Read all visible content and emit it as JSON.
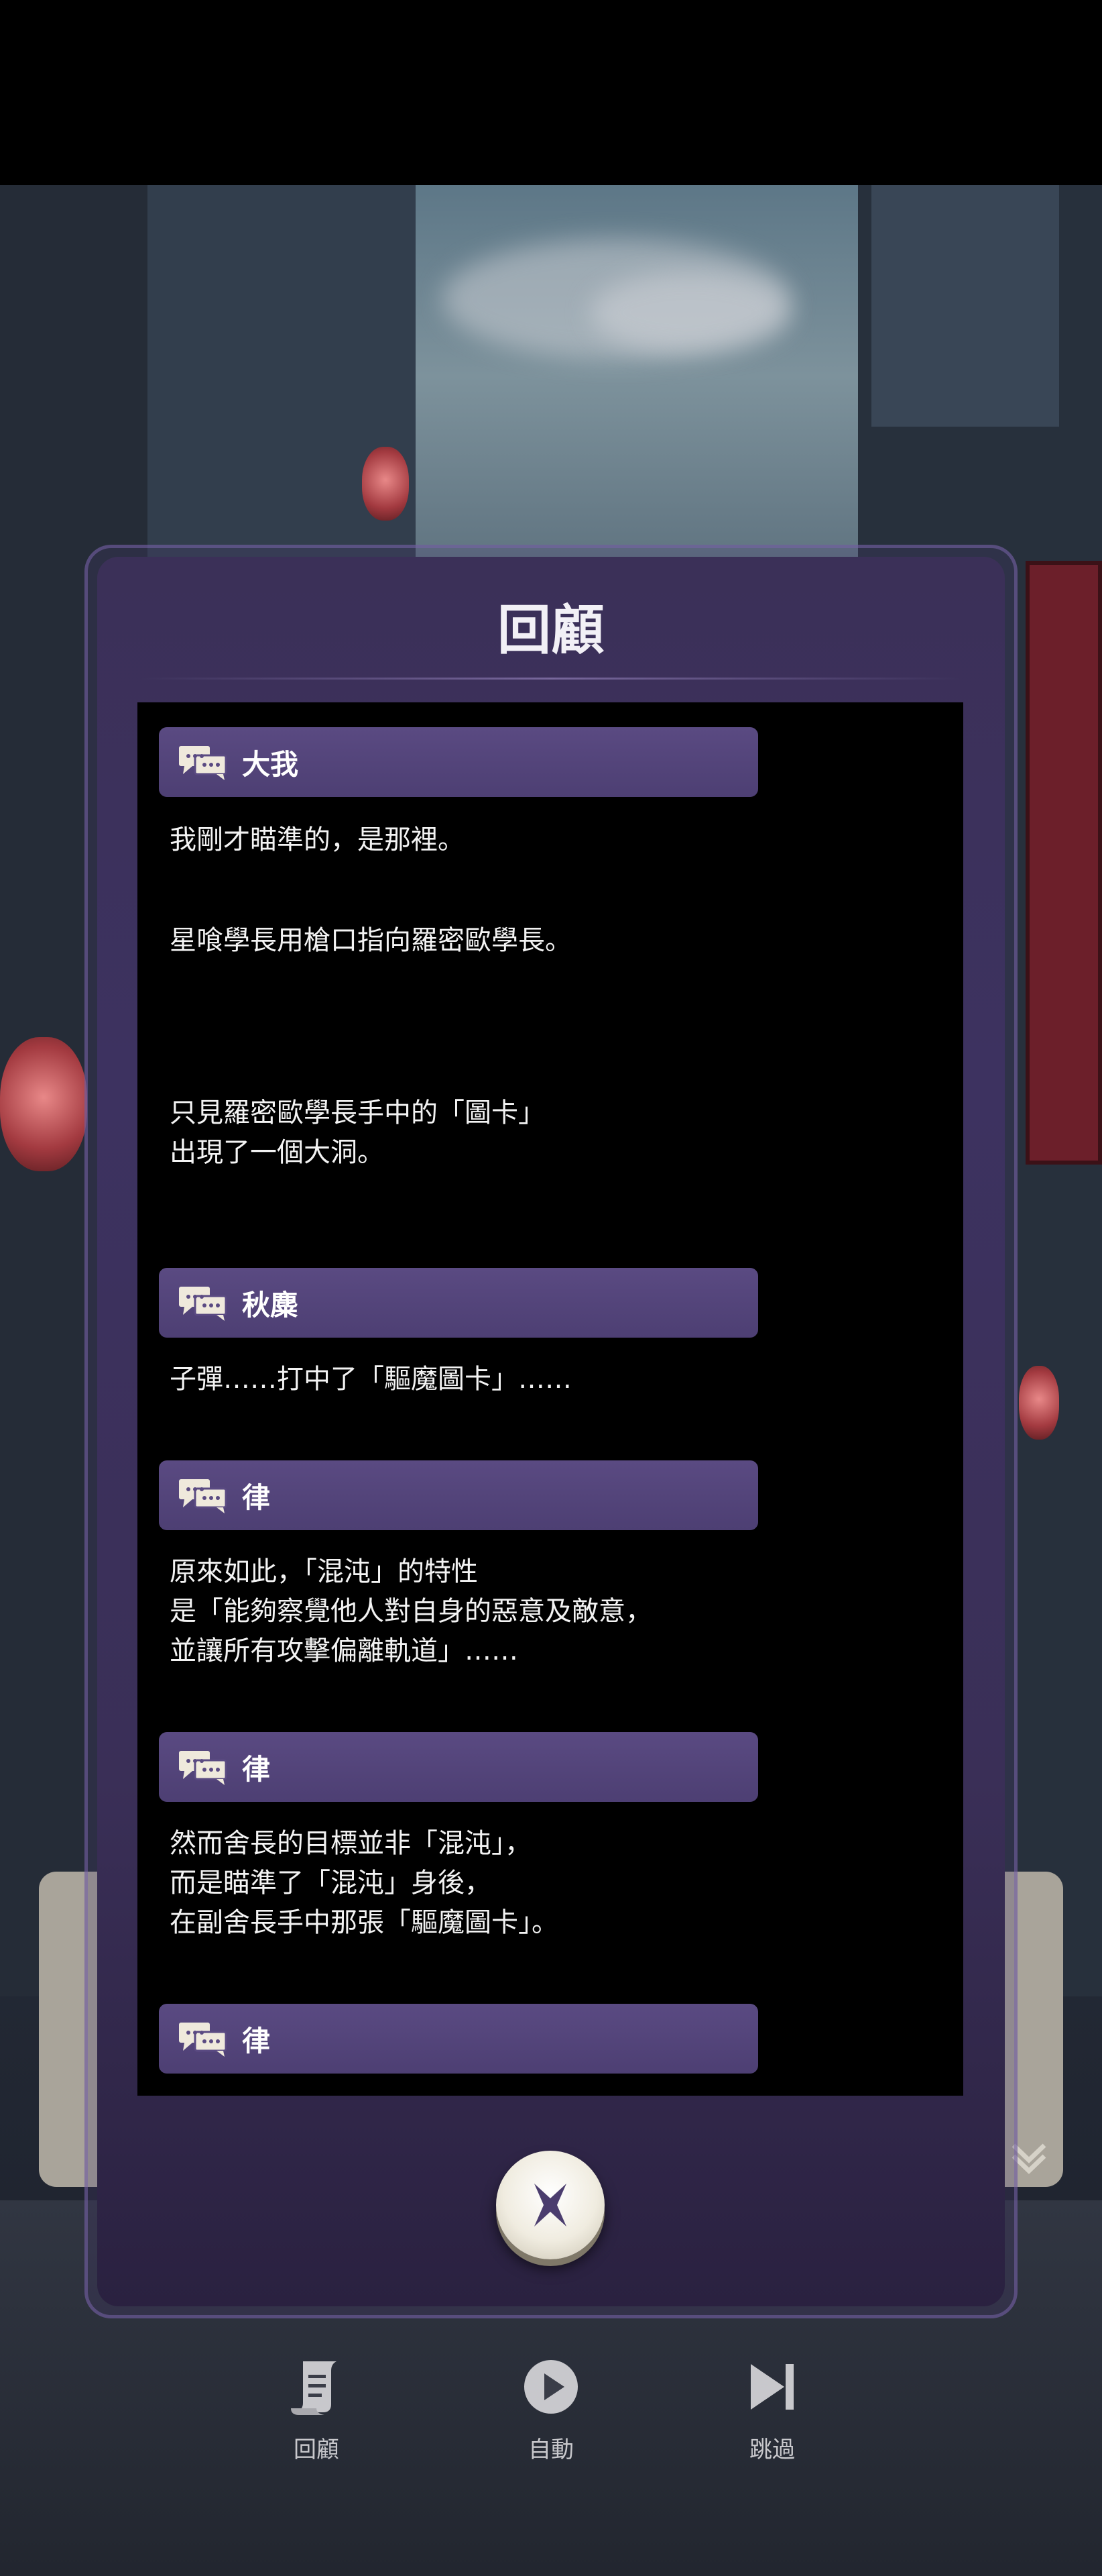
{
  "dialog": {
    "title": "回顧"
  },
  "log": [
    {
      "speaker": "大我",
      "lines": [
        "我剛才瞄準的，是那裡。"
      ]
    },
    {
      "speaker": "",
      "lines": [
        "星喰學長用槍口指向羅密歐學長。"
      ]
    },
    {
      "speaker": "",
      "lines": [
        "只見羅密歐學長手中的「圖卡」",
        "出現了一個大洞。"
      ]
    },
    {
      "speaker": "秋麋",
      "lines": [
        "子彈……打中了「驅魔圖卡」……"
      ]
    },
    {
      "speaker": "律",
      "lines": [
        "原來如此，「混沌」的特性",
        "是「能夠察覺他人對自身的惡意及敵意，",
        "並讓所有攻擊偏離軌道」……"
      ]
    },
    {
      "speaker": "律",
      "lines": [
        "然而舍長的目標並非「混沌」，",
        "而是瞄準了「混沌」身後，",
        "在副舍長手中那張「驅魔圖卡」。"
      ]
    },
    {
      "speaker": "律",
      "lines": []
    }
  ],
  "toolbar": {
    "review_label": "回顧",
    "auto_label": "自動",
    "skip_label": "跳過"
  },
  "icons": {
    "speaker": "speech-bubbles-icon",
    "close": "close-x-icon",
    "review": "scroll-icon",
    "auto": "play-icon",
    "skip": "skip-next-icon",
    "advance": "double-chevron-down-icon"
  },
  "colors": {
    "dialog_bg": "#3b3058",
    "speaker_bar": "#5a4a82",
    "log_bg": "#000000",
    "text": "#f3f3f3"
  }
}
